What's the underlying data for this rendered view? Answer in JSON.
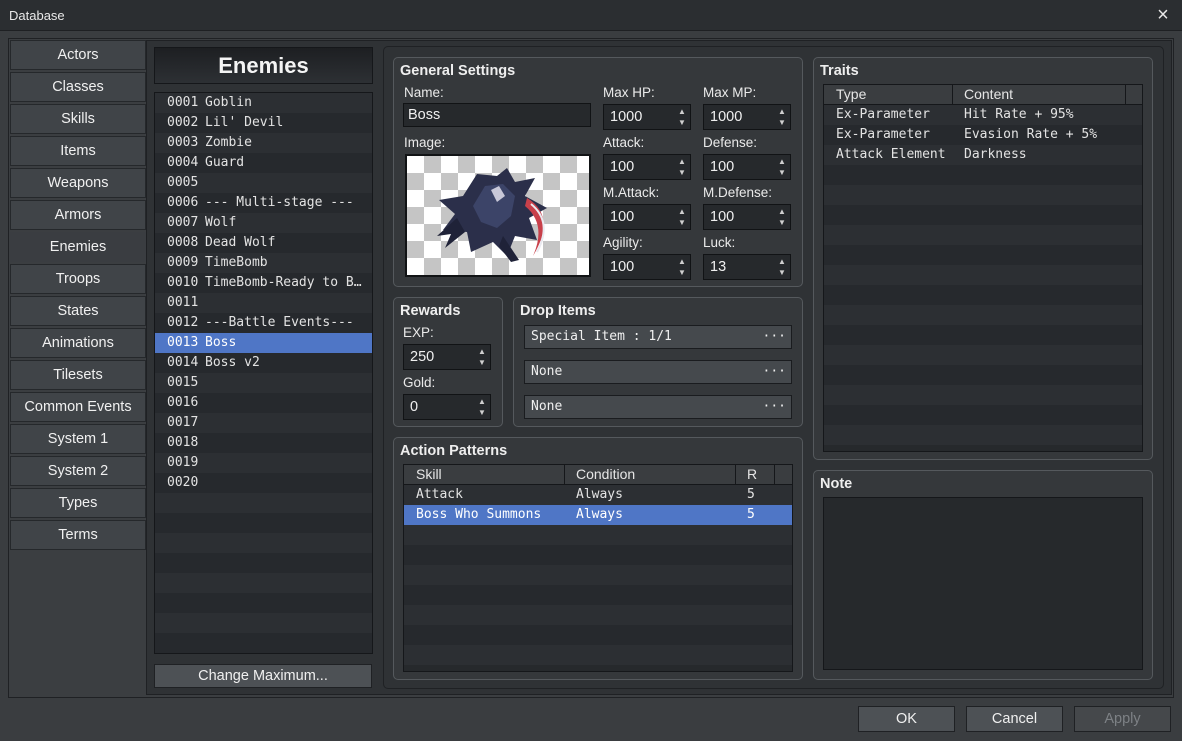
{
  "window": {
    "title": "Database",
    "close_icon": "×"
  },
  "categories": [
    "Actors",
    "Classes",
    "Skills",
    "Items",
    "Weapons",
    "Armors",
    "Enemies",
    "Troops",
    "States",
    "Animations",
    "Tilesets",
    "Common Events",
    "System 1",
    "System 2",
    "Types",
    "Terms"
  ],
  "enemies": {
    "header": "Enemies",
    "list": [
      {
        "id": "0001",
        "name": "Goblin"
      },
      {
        "id": "0002",
        "name": "Lil' Devil"
      },
      {
        "id": "0003",
        "name": "Zombie"
      },
      {
        "id": "0004",
        "name": "Guard"
      },
      {
        "id": "0005",
        "name": ""
      },
      {
        "id": "0006",
        "name": "--- Multi-stage ---"
      },
      {
        "id": "0007",
        "name": "Wolf"
      },
      {
        "id": "0008",
        "name": "Dead Wolf"
      },
      {
        "id": "0009",
        "name": "TimeBomb"
      },
      {
        "id": "0010",
        "name": "TimeBomb-Ready to B…"
      },
      {
        "id": "0011",
        "name": ""
      },
      {
        "id": "0012",
        "name": "---Battle Events---"
      },
      {
        "id": "0013",
        "name": "Boss"
      },
      {
        "id": "0014",
        "name": "Boss v2"
      },
      {
        "id": "0015",
        "name": ""
      },
      {
        "id": "0016",
        "name": ""
      },
      {
        "id": "0017",
        "name": ""
      },
      {
        "id": "0018",
        "name": ""
      },
      {
        "id": "0019",
        "name": ""
      },
      {
        "id": "0020",
        "name": ""
      }
    ],
    "selected_index": 12,
    "change_max_label": "Change Maximum..."
  },
  "general": {
    "title": "General Settings",
    "name_label": "Name:",
    "name_value": "Boss",
    "image_label": "Image:",
    "max_hp_label": "Max HP:",
    "max_hp": "1000",
    "max_mp_label": "Max MP:",
    "max_mp": "1000",
    "attack_label": "Attack:",
    "attack": "100",
    "defense_label": "Defense:",
    "defense": "100",
    "mattack_label": "M.Attack:",
    "mattack": "100",
    "mdefense_label": "M.Defense:",
    "mdefense": "100",
    "agility_label": "Agility:",
    "agility": "100",
    "luck_label": "Luck:",
    "luck": "13"
  },
  "rewards": {
    "title": "Rewards",
    "exp_label": "EXP:",
    "exp": "250",
    "gold_label": "Gold:",
    "gold": "0"
  },
  "drop_items": {
    "title": "Drop Items",
    "items": [
      "Special Item : 1/1",
      "None",
      "None"
    ],
    "more_icon": "···"
  },
  "action_patterns": {
    "title": "Action Patterns",
    "columns": [
      "Skill",
      "Condition",
      "R"
    ],
    "rows": [
      {
        "skill": "Attack",
        "condition": "Always",
        "r": "5"
      },
      {
        "skill": "Boss Who Summons",
        "condition": "Always",
        "r": "5"
      }
    ],
    "selected_index": 1
  },
  "traits": {
    "title": "Traits",
    "columns": [
      "Type",
      "Content"
    ],
    "rows": [
      {
        "type": "Ex-Parameter",
        "content": "Hit Rate + 95%"
      },
      {
        "type": "Ex-Parameter",
        "content": "Evasion Rate + 5%"
      },
      {
        "type": "Attack Element",
        "content": "Darkness"
      }
    ]
  },
  "note": {
    "title": "Note",
    "text": ""
  },
  "footer": {
    "ok": "OK",
    "cancel": "Cancel",
    "apply": "Apply"
  },
  "arrows": {
    "up": "▲",
    "down": "▼"
  }
}
